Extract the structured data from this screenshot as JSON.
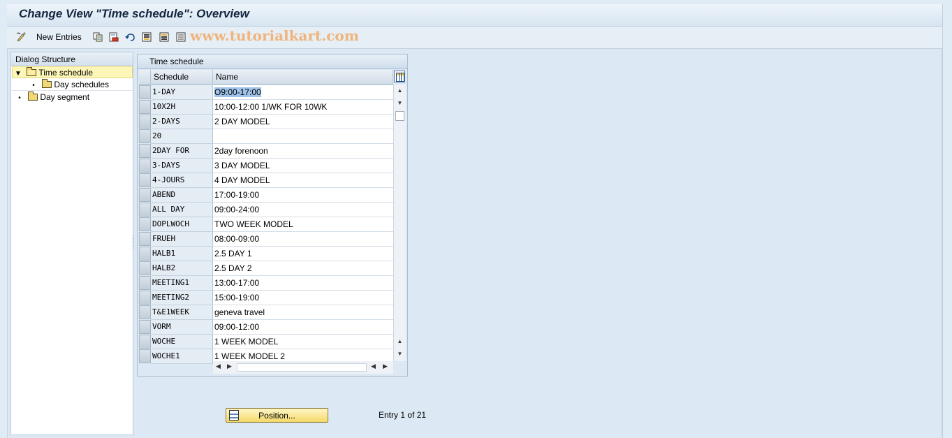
{
  "window": {
    "title": "Change View \"Time schedule\": Overview"
  },
  "toolbar": {
    "new_entries_label": "New Entries",
    "watermark": "www.tutorialkart.com",
    "icons": [
      "display-change-icon",
      "copy-icon",
      "delete-icon",
      "undo-icon",
      "select-all-icon",
      "select-block-icon",
      "deselect-all-icon"
    ]
  },
  "dialog_structure": {
    "header": "Dialog Structure",
    "items": [
      {
        "label": "Time schedule",
        "level": 0,
        "expanded": true,
        "selected": true
      },
      {
        "label": "Day schedules",
        "level": 1,
        "expanded": false,
        "selected": false
      },
      {
        "label": "Day segment",
        "level": 0,
        "expanded": false,
        "selected": false
      }
    ]
  },
  "table": {
    "caption": "Time schedule",
    "columns": [
      "Schedule",
      "Name"
    ],
    "rows": [
      [
        "1-DAY",
        "O9:00-17:00"
      ],
      [
        "10X2H",
        "10:00-12:00 1/WK FOR 10WK"
      ],
      [
        "2-DAYS",
        "2 DAY MODEL"
      ],
      [
        "20",
        ""
      ],
      [
        "2DAY FOR",
        "2day forenoon"
      ],
      [
        "3-DAYS",
        "3 DAY MODEL"
      ],
      [
        "4-JOURS",
        "4 DAY MODEL"
      ],
      [
        "ABEND",
        "17:00-19:00"
      ],
      [
        "ALL DAY",
        "09:00-24:00"
      ],
      [
        "DOPLWOCH",
        "TWO WEEK MODEL"
      ],
      [
        "FRUEH",
        "08:00-09:00"
      ],
      [
        "HALB1",
        "2.5 DAY 1"
      ],
      [
        "HALB2",
        "2.5 DAY 2"
      ],
      [
        "MEETING1",
        "13:00-17:00"
      ],
      [
        "MEETING2",
        "15:00-19:00"
      ],
      [
        "T&E1WEEK",
        "geneva travel"
      ],
      [
        "VORM",
        "09:00-12:00"
      ],
      [
        "WOCHE",
        "1 WEEK MODEL"
      ],
      [
        "WOCHE1",
        "1 WEEK MODEL 2"
      ]
    ]
  },
  "footer": {
    "position_button": "Position...",
    "entry_text": "Entry 1 of 21"
  },
  "colors": {
    "background": "#dfebf5",
    "selection": "#fcf6b8",
    "highlight": "#9fc3e9",
    "button": "#f4d96a"
  }
}
